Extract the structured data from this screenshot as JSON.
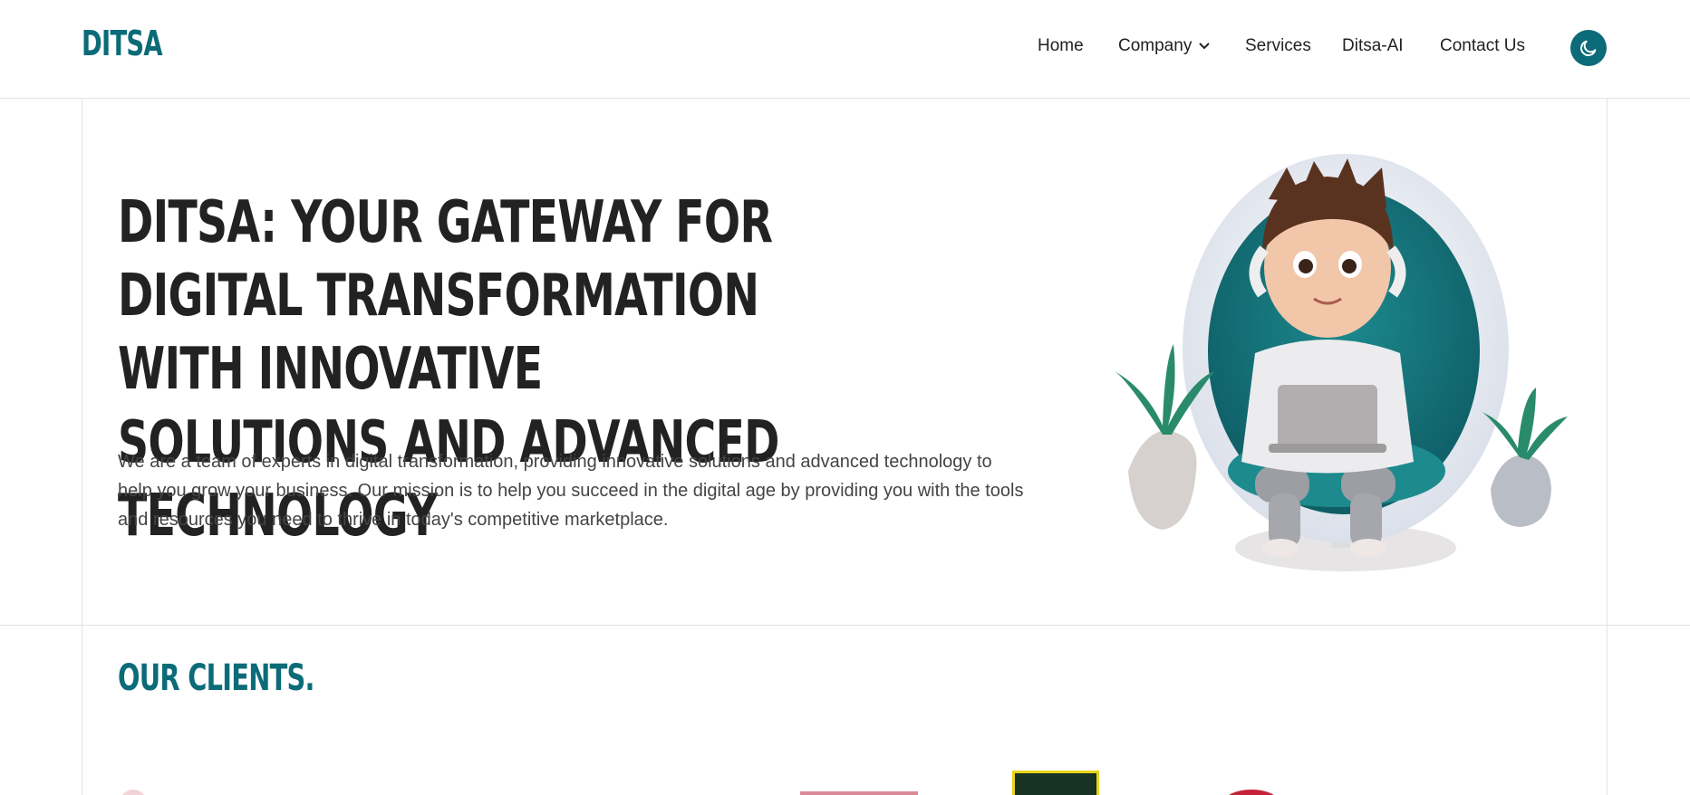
{
  "header": {
    "logo": "DITSA",
    "nav": [
      {
        "label": "Home"
      },
      {
        "label": "Company"
      },
      {
        "label": "Services"
      },
      {
        "label": "Ditsa-AI"
      },
      {
        "label": "Contact Us"
      }
    ],
    "theme_toggle_icon": "moon-icon"
  },
  "hero": {
    "title": "DITSA: YOUR GATEWAY FOR DIGITAL TRANSFORMATION WITH INNOVATIVE SOLUTIONS AND ADVANCED TECHNOLOGY",
    "description": "We are a team of experts in digital transformation, providing innovative solutions and advanced technology to help you grow your business. Our mission is to help you succeed in the digital age by providing you with the tools and resources you need to thrive in today's competitive marketplace."
  },
  "clients": {
    "title": "OUR CLIENTS."
  },
  "colors": {
    "accent": "#0b6b78",
    "text": "#222222",
    "border": "#e3e3e3"
  }
}
